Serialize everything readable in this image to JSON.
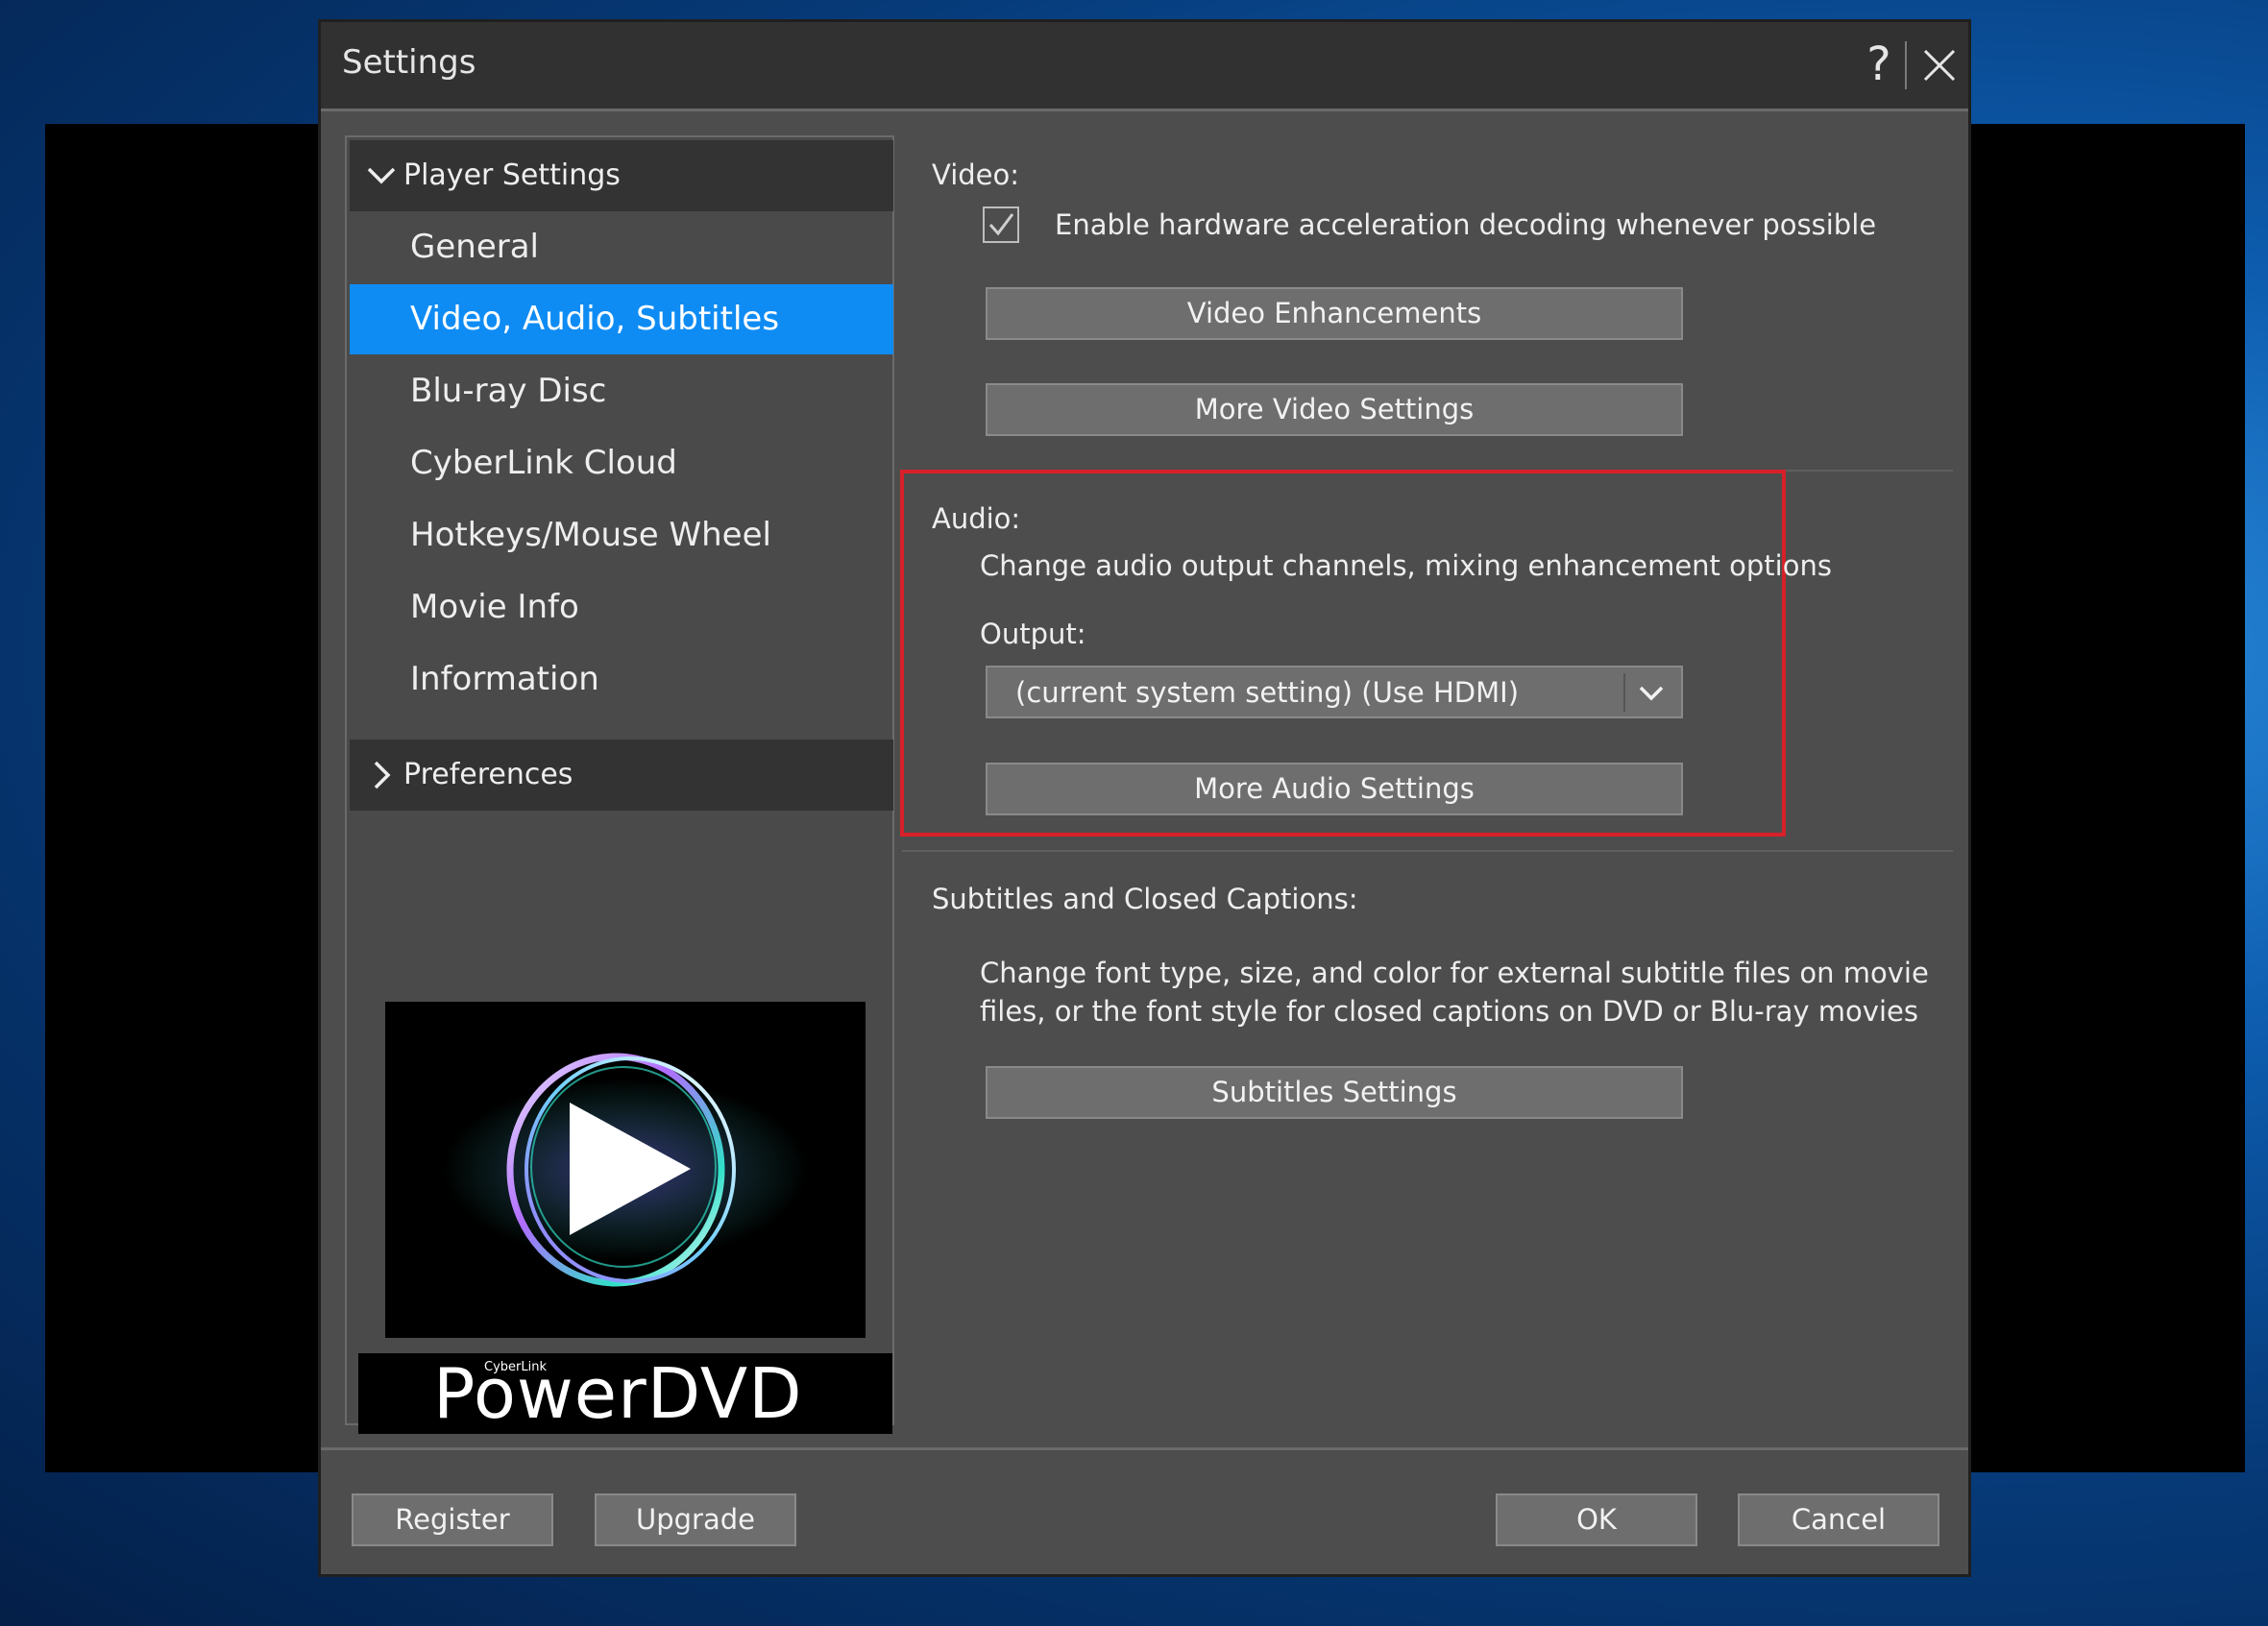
{
  "window": {
    "title": "Settings",
    "help_glyph": "?"
  },
  "nav": {
    "group_player": "Player Settings",
    "items": [
      "General",
      "Video, Audio, Subtitles",
      "Blu-ray Disc",
      "CyberLink Cloud",
      "Hotkeys/Mouse Wheel",
      "Movie Info",
      "Information"
    ],
    "active_item": "Video, Audio, Subtitles",
    "group_preferences": "Preferences"
  },
  "logo": {
    "brand_small": "CyberLink",
    "brand": "PowerDVD"
  },
  "video": {
    "label": "Video:",
    "hw_accel_label": "Enable hardware acceleration decoding whenever possible",
    "hw_accel_checked": true,
    "enhancements_button": "Video Enhancements",
    "more_button": "More Video Settings"
  },
  "audio": {
    "label": "Audio:",
    "description": "Change audio output channels, mixing enhancement options",
    "output_label": "Output:",
    "output_value": "(current system setting) (Use HDMI)",
    "more_button": "More Audio Settings",
    "highlight_color": "#d8202a"
  },
  "subtitles": {
    "label": "Subtitles and Closed Captions:",
    "description_line1": "Change font type, size, and color for external subtitle files on movie",
    "description_line2": "files, or the font style for closed captions on DVD or Blu-ray movies",
    "button": "Subtitles Settings"
  },
  "footer": {
    "register": "Register",
    "upgrade": "Upgrade",
    "ok": "OK",
    "cancel": "Cancel"
  },
  "colors": {
    "accent": "#0f8cf4",
    "dialog_bg": "#4d4d4d",
    "titlebar_bg": "#313131"
  }
}
